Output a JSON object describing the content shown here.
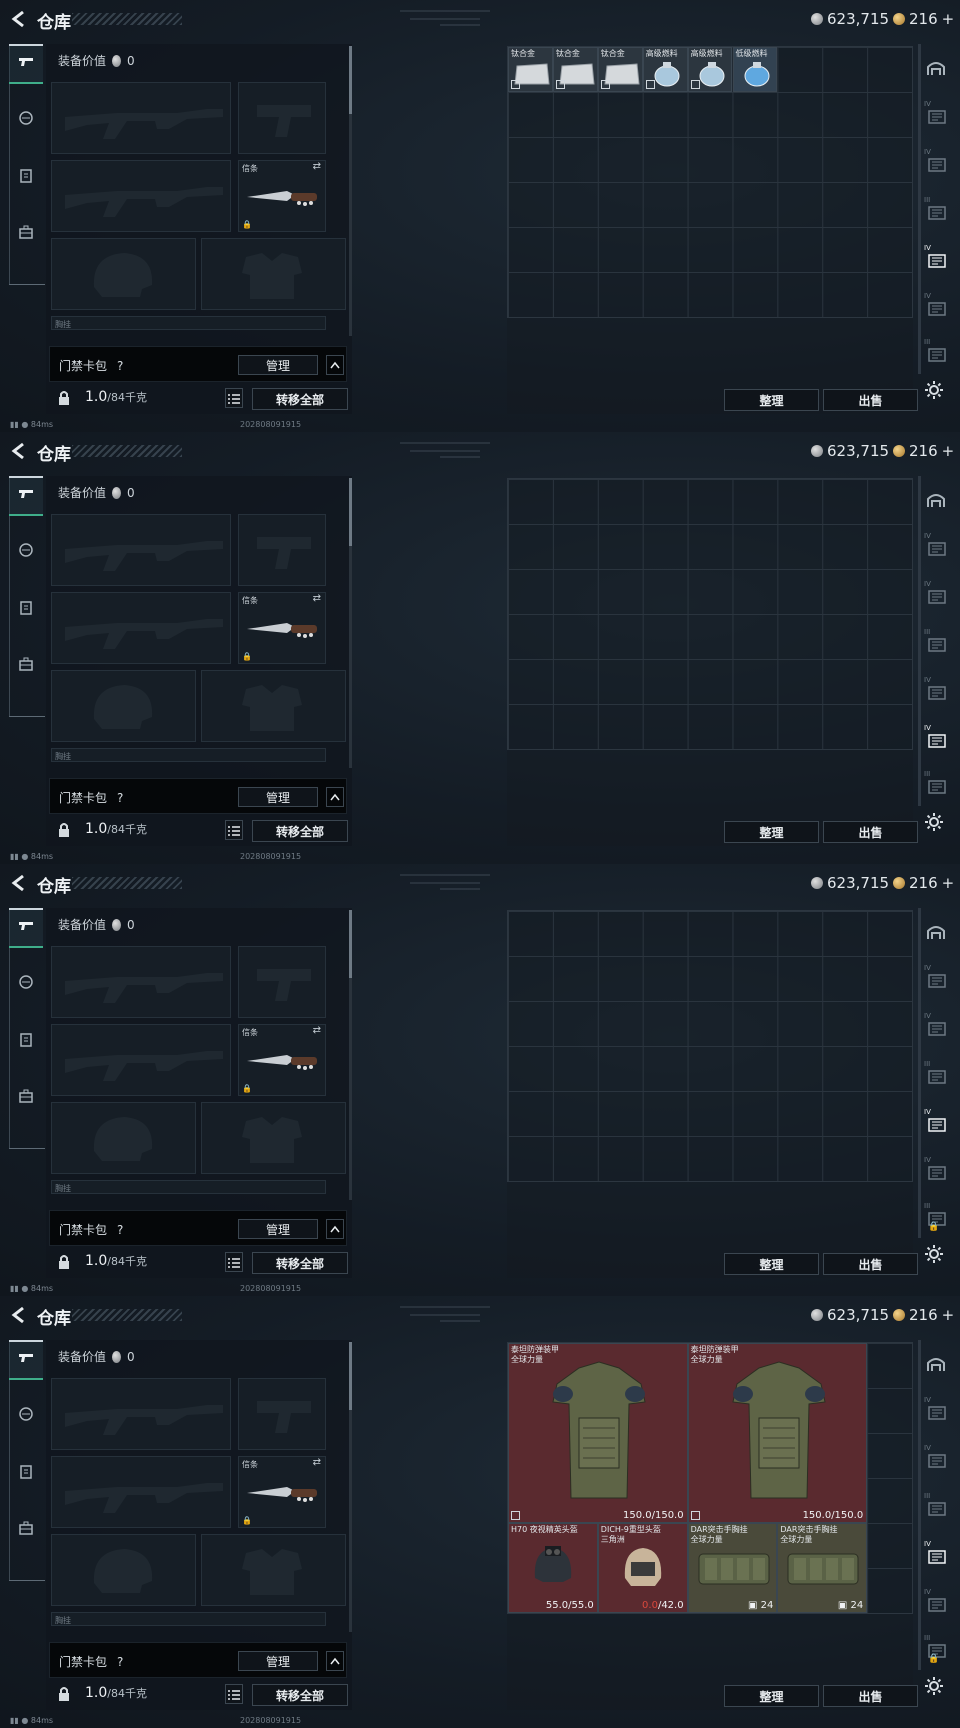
{
  "header": {
    "title": "仓库",
    "silver_amount": "623,715",
    "gold_amount": "216",
    "gold_plus": "+"
  },
  "equipment": {
    "value_label": "装备价值",
    "value": "0",
    "knife_slot_label": "信条",
    "collapsed_label": "胸挂"
  },
  "access_card": {
    "label": "门禁卡包",
    "help": "?",
    "manage_label": "管理",
    "collapse_glyph": "^"
  },
  "weight": {
    "current": "1.0",
    "max": "/84千克"
  },
  "buttons": {
    "transfer_all": "转移全部",
    "sort": "整理",
    "sell": "出售"
  },
  "status": {
    "ping": "84ms",
    "timestamp": "202808091915"
  },
  "right_tabs": [
    "IV",
    "IV",
    "III",
    "IV",
    "IV",
    "III",
    "IV",
    "IV",
    "IV"
  ],
  "frames": [
    {
      "active_right_tab": 4,
      "items": [
        {
          "name": "钛合金",
          "kind": "ingot"
        },
        {
          "name": "钛合金",
          "kind": "ingot"
        },
        {
          "name": "钛合金",
          "kind": "ingot"
        },
        {
          "name": "高级燃料",
          "kind": "fuel"
        },
        {
          "name": "高级燃料",
          "kind": "fuel"
        },
        {
          "name": "低级燃料",
          "kind": "fuel-low"
        }
      ]
    },
    {
      "active_right_tab": 5,
      "items": []
    },
    {
      "active_right_tab": 4,
      "items": []
    },
    {
      "active_right_tab": 4,
      "armor": [
        {
          "name": "泰坦防弹装甲",
          "sub": "全球力量",
          "durability": "150.0/150.0"
        },
        {
          "name": "泰坦防弹装甲",
          "sub": "全球力量",
          "durability": "150.0/150.0"
        }
      ],
      "helmets": [
        {
          "name": "H70 夜视精英头盔",
          "sub": "",
          "cur": "55.0",
          "max": "/55.0",
          "low": false
        },
        {
          "name": "DICH-9重型头盔",
          "sub": "三角洲",
          "cur": "0.0",
          "max": "/42.0",
          "low": true
        }
      ],
      "rigs": [
        {
          "name": "DAR突击手胸挂",
          "sub": "全球力量",
          "count": "24"
        },
        {
          "name": "DAR突击手胸挂",
          "sub": "全球力量",
          "count": "24"
        }
      ]
    }
  ],
  "colors": {
    "active_green": "#3fae8a",
    "armor_bg": "#5a2a2f",
    "low_red": "#d9473c"
  }
}
